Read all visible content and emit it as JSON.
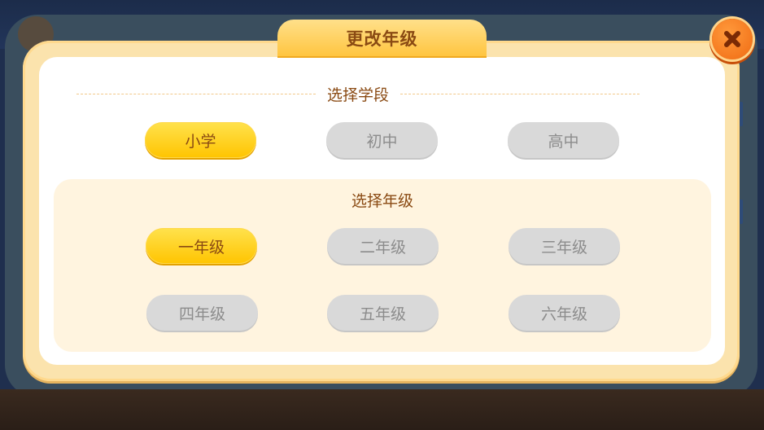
{
  "dialog": {
    "title": "更改年级",
    "close_icon": "close-icon"
  },
  "stage_section": {
    "title": "选择学段",
    "options": [
      "小学",
      "初中",
      "高中"
    ],
    "selected": "小学"
  },
  "grade_section": {
    "title": "选择年级",
    "options": [
      "一年级",
      "二年级",
      "三年级",
      "四年级",
      "五年级",
      "六年级"
    ],
    "selected": "一年级"
  },
  "colors": {
    "active": "#ffc400",
    "inactive": "#d9d9d9",
    "title_text": "#8a4a13",
    "close_button": "#f06a12"
  }
}
